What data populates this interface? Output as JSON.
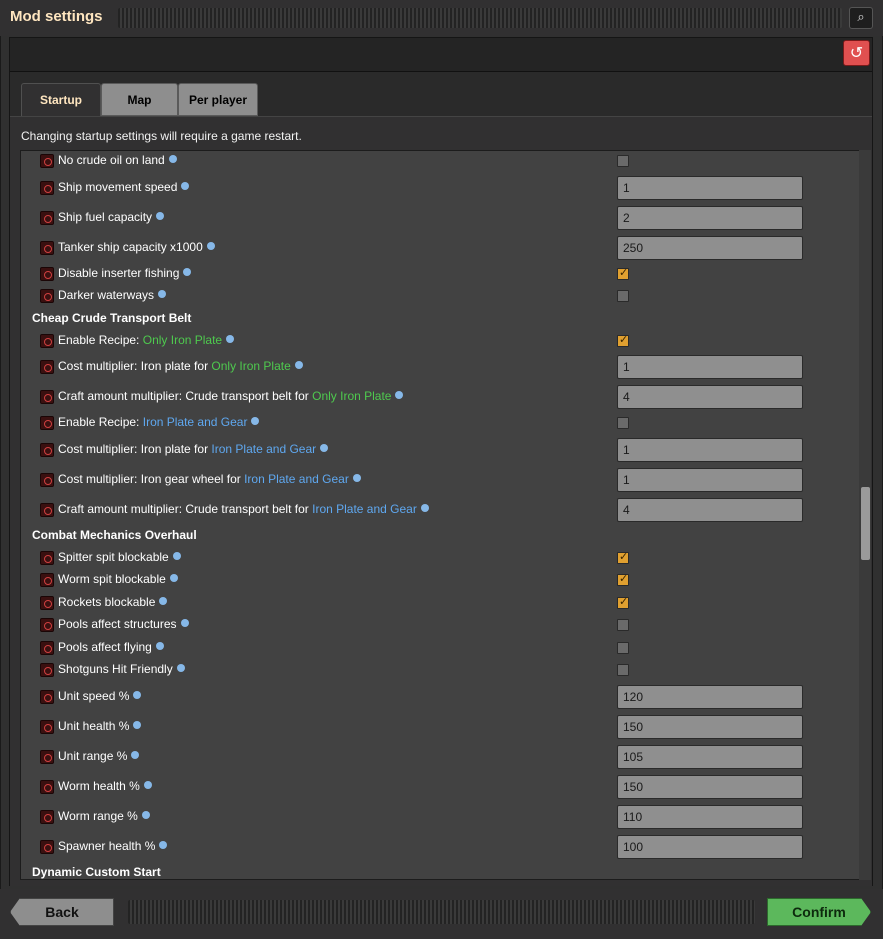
{
  "window": {
    "title": "Mod settings"
  },
  "tabs": [
    {
      "label": "Startup",
      "active": true
    },
    {
      "label": "Map",
      "active": false
    },
    {
      "label": "Per player",
      "active": false
    }
  ],
  "notice": "Changing startup settings will require a game restart.",
  "settings": [
    {
      "kind": "setting",
      "label": "No crude oil on land",
      "control": "checkbox",
      "checked": false
    },
    {
      "kind": "setting",
      "label": "Ship movement speed",
      "control": "text",
      "value": "1"
    },
    {
      "kind": "setting",
      "label": "Ship fuel capacity",
      "control": "text",
      "value": "2"
    },
    {
      "kind": "setting",
      "label": "Tanker ship capacity x1000",
      "control": "text",
      "value": "250"
    },
    {
      "kind": "setting",
      "label": "Disable inserter fishing",
      "control": "checkbox",
      "checked": true
    },
    {
      "kind": "setting",
      "label": "Darker waterways",
      "control": "checkbox",
      "checked": false
    },
    {
      "kind": "group",
      "label": "Cheap Crude Transport Belt"
    },
    {
      "kind": "setting",
      "label": "Enable Recipe: ",
      "highlight": "Only Iron Plate",
      "highlight_color": "green",
      "control": "checkbox",
      "checked": true
    },
    {
      "kind": "setting",
      "label": "Cost multiplier: Iron plate for ",
      "highlight": "Only Iron Plate",
      "highlight_color": "green",
      "control": "text",
      "value": "1"
    },
    {
      "kind": "setting",
      "label": "Craft amount multiplier: Crude transport belt for ",
      "highlight": "Only Iron Plate",
      "highlight_color": "green",
      "control": "text",
      "value": "4"
    },
    {
      "kind": "setting",
      "label": "Enable Recipe: ",
      "highlight": "Iron Plate and Gear",
      "highlight_color": "blue",
      "control": "checkbox",
      "checked": false
    },
    {
      "kind": "setting",
      "label": "Cost multiplier: Iron plate for ",
      "highlight": "Iron Plate and Gear",
      "highlight_color": "blue",
      "control": "text",
      "value": "1"
    },
    {
      "kind": "setting",
      "label": "Cost multiplier: Iron gear wheel for ",
      "highlight": "Iron Plate and Gear",
      "highlight_color": "blue",
      "control": "text",
      "value": "1"
    },
    {
      "kind": "setting",
      "label": "Craft amount multiplier: Crude transport belt for ",
      "highlight": "Iron Plate and Gear",
      "highlight_color": "blue",
      "control": "text",
      "value": "4"
    },
    {
      "kind": "group",
      "label": "Combat Mechanics Overhaul"
    },
    {
      "kind": "setting",
      "label": "Spitter spit blockable",
      "control": "checkbox",
      "checked": true
    },
    {
      "kind": "setting",
      "label": "Worm spit blockable",
      "control": "checkbox",
      "checked": true
    },
    {
      "kind": "setting",
      "label": "Rockets blockable",
      "control": "checkbox",
      "checked": true
    },
    {
      "kind": "setting",
      "label": "Pools affect structures",
      "control": "checkbox",
      "checked": false
    },
    {
      "kind": "setting",
      "label": "Pools affect flying",
      "control": "checkbox",
      "checked": false
    },
    {
      "kind": "setting",
      "label": "Shotguns Hit Friendly",
      "control": "checkbox",
      "checked": false
    },
    {
      "kind": "setting",
      "label": "Unit speed %",
      "control": "text",
      "value": "120"
    },
    {
      "kind": "setting",
      "label": "Unit health %",
      "control": "text",
      "value": "150"
    },
    {
      "kind": "setting",
      "label": "Unit range %",
      "control": "text",
      "value": "105"
    },
    {
      "kind": "setting",
      "label": "Worm health %",
      "control": "text",
      "value": "150"
    },
    {
      "kind": "setting",
      "label": "Worm range %",
      "control": "text",
      "value": "110"
    },
    {
      "kind": "setting",
      "label": "Spawner health %",
      "control": "text",
      "value": "100"
    },
    {
      "kind": "group",
      "label": "Dynamic Custom Start"
    }
  ],
  "footer": {
    "back_label": "Back",
    "confirm_label": "Confirm"
  },
  "colors": {
    "accent_green": "#5cb85c",
    "checkbox_on": "#e0a030",
    "reset": "#e05050",
    "highlight_green": "#4ec94e",
    "highlight_blue": "#5fa8f0"
  }
}
